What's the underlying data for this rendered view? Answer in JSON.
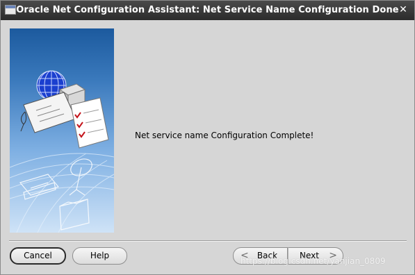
{
  "window": {
    "title": "Oracle Net Configuration Assistant: Net Service Name Configuration Done",
    "close_glyph": "✕"
  },
  "main": {
    "message": "Net service name Configuration Complete!"
  },
  "buttons": {
    "cancel": "Cancel",
    "help": "Help",
    "back": "Back",
    "next": "Next",
    "back_icon": "<",
    "next_icon": ">"
  },
  "watermark": "https://blog.csdn.net/yanjian_0809",
  "colors": {
    "titlebar": "#2b2b2b",
    "dialog_bg": "#d6d6d6",
    "panel_top": "#1c5a9e",
    "panel_bottom": "#cfe3f7"
  }
}
